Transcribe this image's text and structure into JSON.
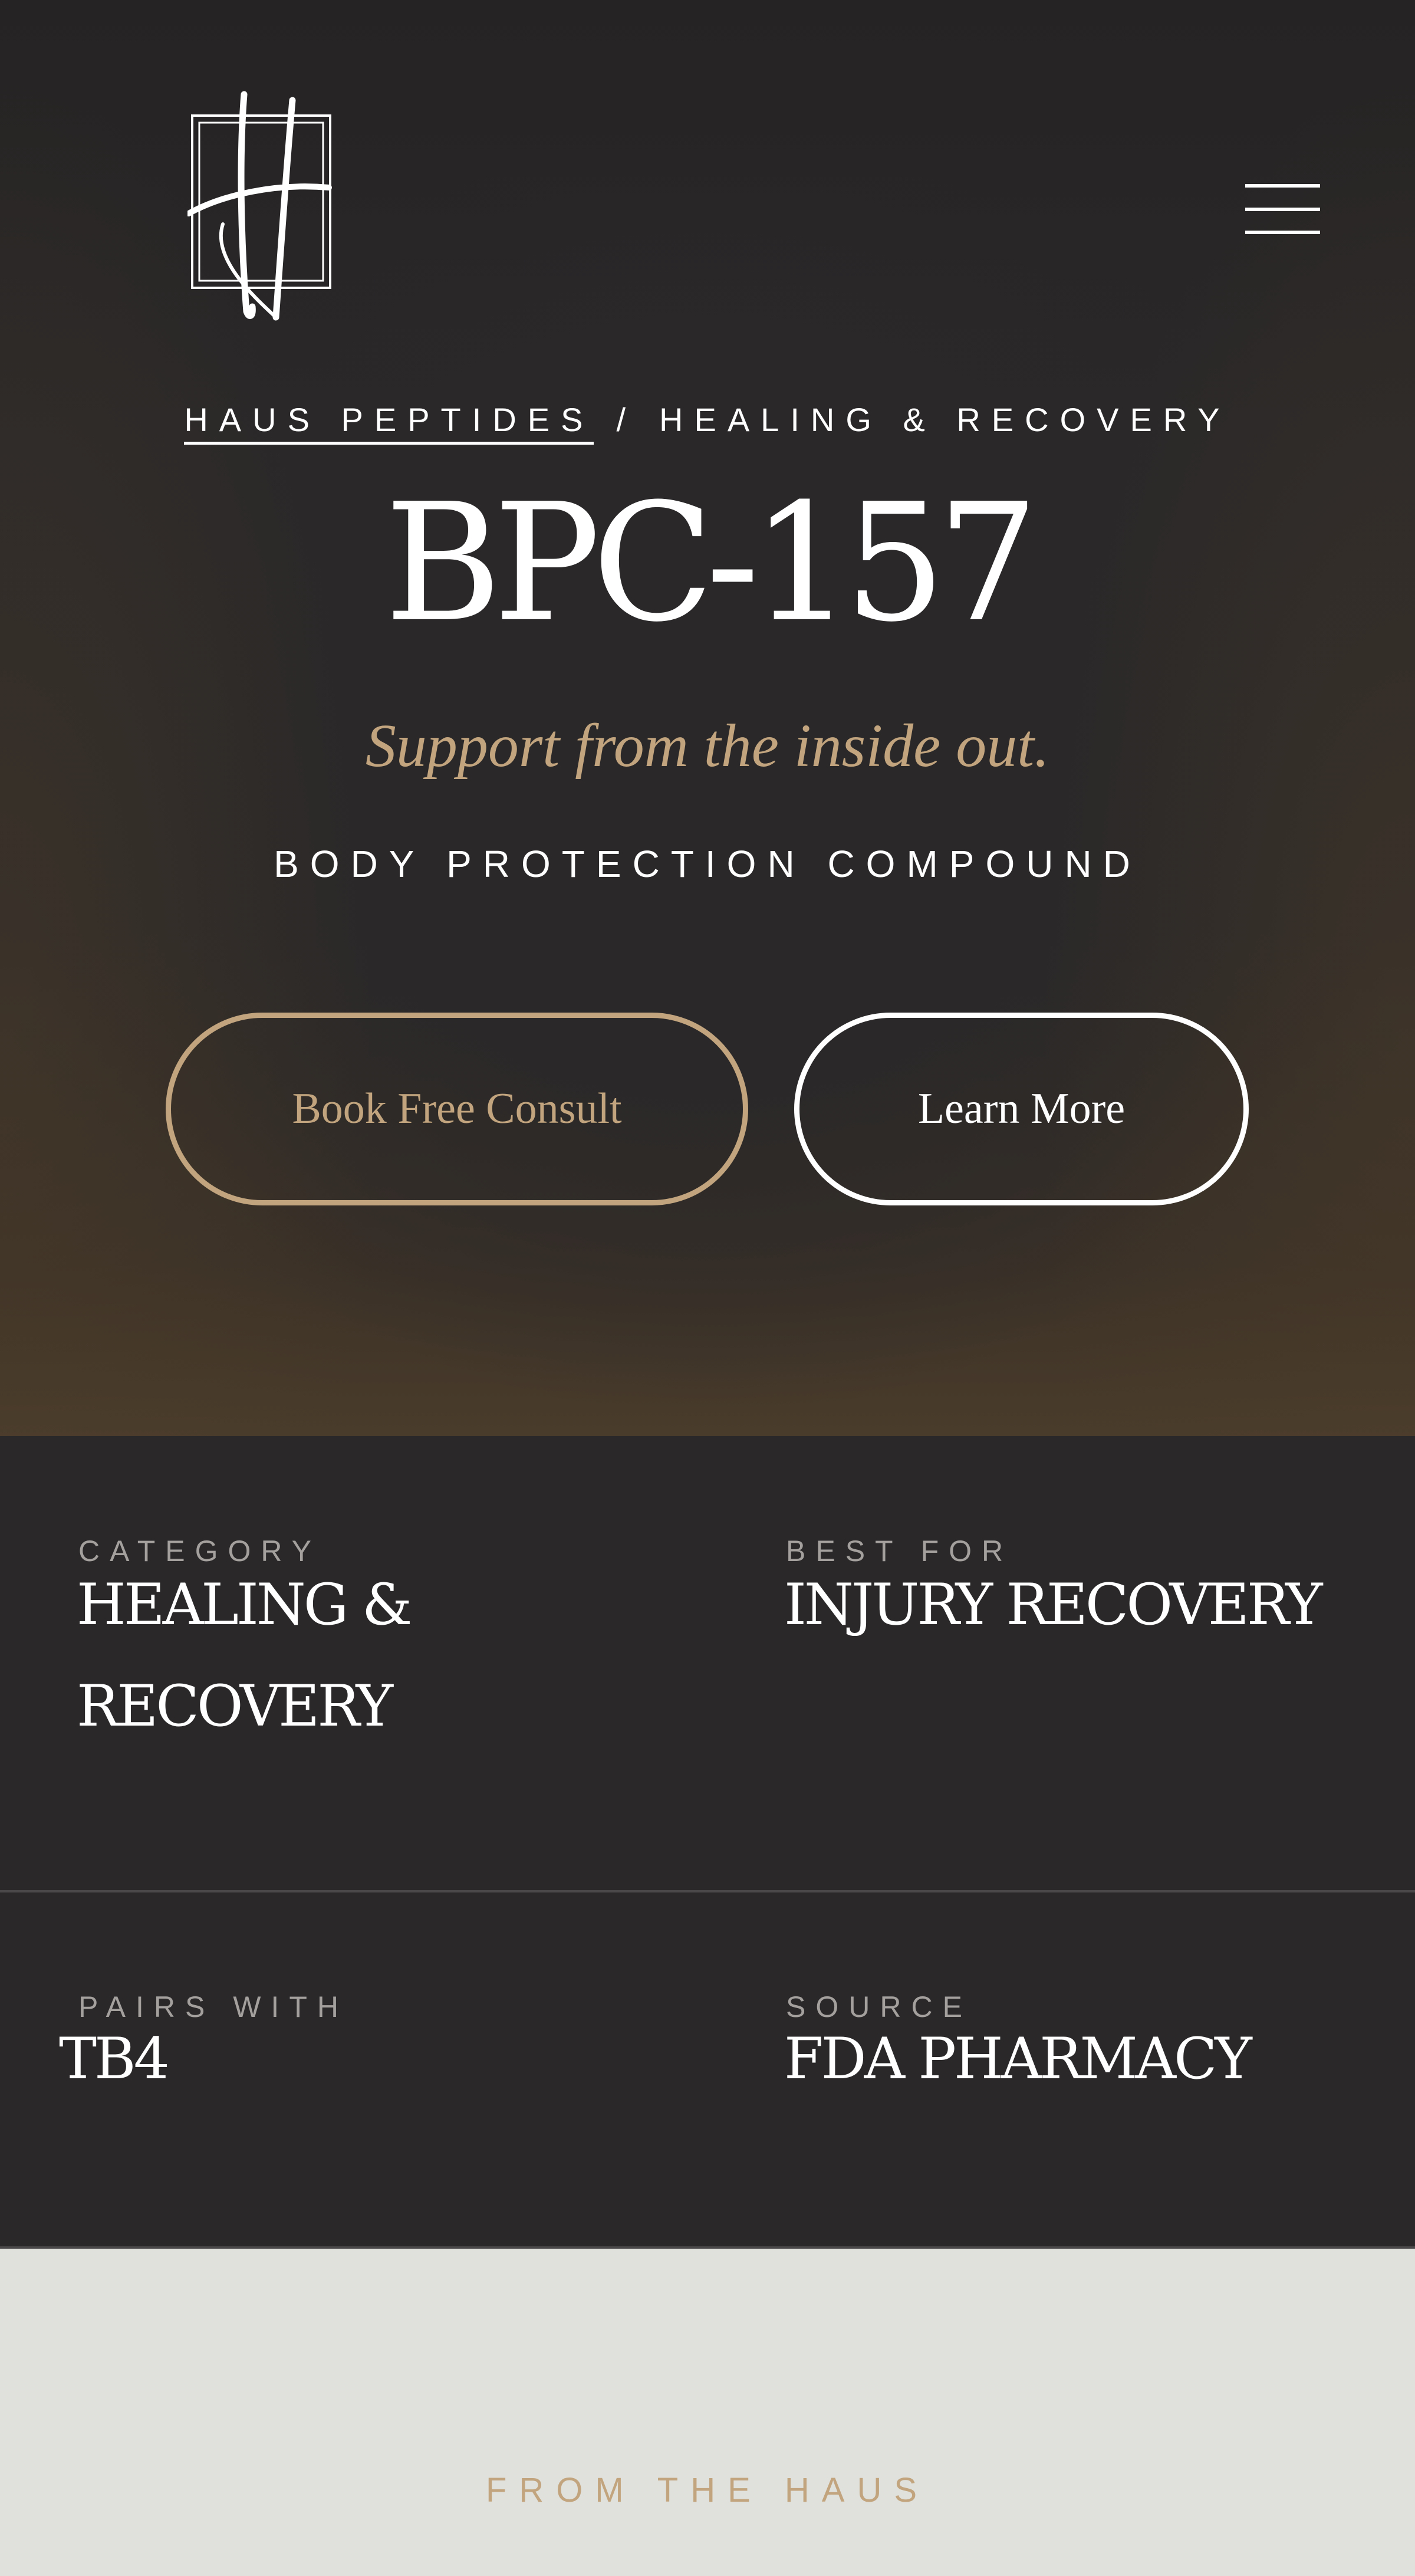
{
  "brand": {
    "logo_icon": "monogram-h-logo"
  },
  "header": {
    "menu_icon": "hamburger-menu-icon"
  },
  "breadcrumb": {
    "home": "HAUS PEPTIDES",
    "separator": "/",
    "current": "HEALING & RECOVERY"
  },
  "product": {
    "title": "BPC-157",
    "tagline": "Support from the inside out.",
    "subtitle": "BODY PROTECTION COMPOUND"
  },
  "actions": {
    "consult_label": "Book Free Consult",
    "learn_label": "Learn More"
  },
  "details": {
    "category": {
      "label": "CATEGORY",
      "value_line1": "Healing &",
      "value_line2": "Recovery"
    },
    "best_for": {
      "label": "BEST FOR",
      "value": "Injury Recovery"
    },
    "pairs_with": {
      "label": "PAIRS WITH",
      "value": "TB4"
    },
    "source": {
      "label": "SOURCE",
      "value": "FDA Pharmacy"
    }
  },
  "lower": {
    "label": "FROM THE HAUS"
  },
  "colors": {
    "background_dark": "#2a2829",
    "accent_gold": "#c2a57e",
    "text_light": "#ffffff",
    "label_grey": "#a3a09e",
    "lower_background": "#e0e1dd"
  }
}
